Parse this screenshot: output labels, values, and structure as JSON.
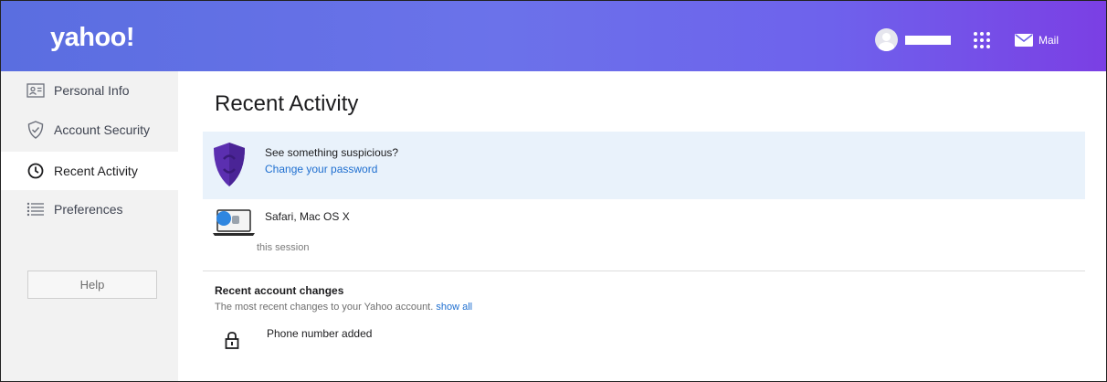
{
  "header": {
    "logo": "yahoo!",
    "mail_label": "Mail"
  },
  "sidebar": {
    "items": [
      {
        "label": "Personal Info",
        "icon": "id-card-icon"
      },
      {
        "label": "Account Security",
        "icon": "shield-check-icon"
      },
      {
        "label": "Recent Activity",
        "icon": "clock-icon",
        "active": true
      },
      {
        "label": "Preferences",
        "icon": "list-icon"
      }
    ],
    "help_label": "Help"
  },
  "main": {
    "title": "Recent Activity",
    "alert": {
      "title": "See something suspicious?",
      "link": "Change your password"
    },
    "session": {
      "device": "Safari, Mac OS X",
      "note": "this session"
    },
    "changes": {
      "title": "Recent account changes",
      "subtitle": "The most recent changes to your Yahoo account.",
      "show_all": "show all",
      "items": [
        {
          "label": "Phone number added",
          "icon": "lock-icon"
        }
      ]
    }
  },
  "colors": {
    "header_start": "#5a6ee0",
    "header_end": "#7b3fe4",
    "link": "#1f6fd0",
    "alert_bg": "#e9f2fb",
    "sidebar_bg": "#f2f2f2",
    "shield": "#5b2fb0"
  }
}
